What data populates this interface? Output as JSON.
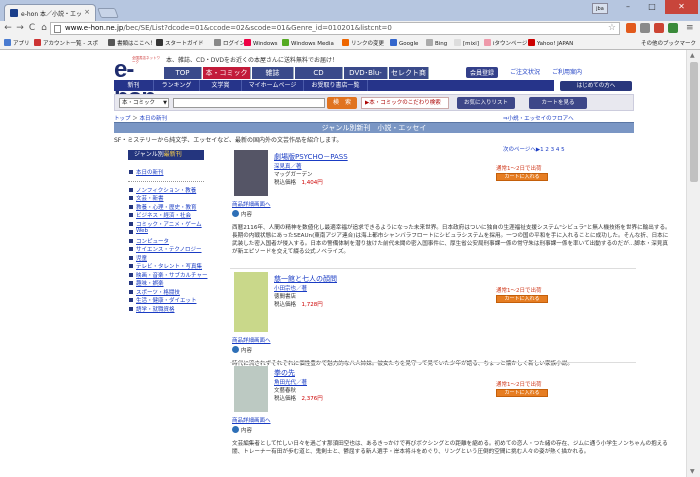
{
  "browser": {
    "tab_title": "e-hon 本／小説・エッセイ",
    "tab_close": "×",
    "user_badge": "jba",
    "win_min": "–",
    "win_max": "□",
    "win_close": "✕",
    "back": "←",
    "forward": "→",
    "reload": "C",
    "home": "⌂",
    "url_host": "www.e-hon.ne.jp",
    "url_path": "/bec/SE/List?dcode=01&ccode=02&scode=01&Genre_id=010201&listcnt=0",
    "star": "☆",
    "menu": "≡",
    "bookmarks": [
      {
        "label": "アプリ",
        "color": "#4a7bd0"
      },
      {
        "label": "アカウント一覧 - スポ",
        "color": "#c33"
      },
      {
        "label": "書類はここへ！",
        "color": "#555"
      },
      {
        "label": "スタートガイド",
        "color": "#333"
      },
      {
        "label": "ログイン",
        "color": "#888"
      },
      {
        "label": "Windows",
        "color": "#e04"
      },
      {
        "label": "Windows Media",
        "color": "#5a2"
      },
      {
        "label": "リンクの変更",
        "color": "#e60"
      },
      {
        "label": "Google",
        "color": "#36c"
      },
      {
        "label": "Bing",
        "color": "#aaa"
      },
      {
        "label": "[mixi]",
        "color": "#ddd"
      },
      {
        "label": "iタウンページ",
        "color": "#e9a"
      },
      {
        "label": "Yahoo! JAPAN",
        "color": "#c00"
      }
    ],
    "other_bookmarks": "その他のブックマーク"
  },
  "site": {
    "logo_text": "e-hon",
    "logo_sub": "全国書店ネットワーク",
    "tagline": "本、雑誌、CD・DVDをお近くの本屋さんに送料無料でお届け！",
    "main_nav": [
      "TOP",
      "本・コミック",
      "雑誌",
      "CD",
      "DVD･Blu-ray",
      "セレクト商品"
    ],
    "member": "会員登録",
    "help1": "ご注文状況",
    "help2": "ご利用案内",
    "beginner": "はじめての方へ",
    "sub_nav": [
      "新刊",
      "ランキング",
      "文学賞",
      "マイホームページ",
      "お受取り書店一覧"
    ],
    "search_select": "本・コミック",
    "search_select_arrow": "▼",
    "search_button": "検　索",
    "kodawari": "▶本・コミックのこだわり検索",
    "favorites": "お気に入りリスト",
    "cart": "カートを見る",
    "crumb": [
      "トップ",
      "本日の新刊"
    ],
    "crumb_sep": " ＞ ",
    "cat_link": "⇒小説・エッセイのフロアへ",
    "genre_title": "ジャンル別新刊　小説・エッセイ",
    "genre_desc": "SF・ミステリーから純文学、エッセイなど、最新の国内外の文芸作品を紹介します。",
    "pager": "次のページへ▶1 2 3 4 5"
  },
  "sidebar": {
    "head1": "ジャンル別",
    "head2": "最新刊",
    "items": [
      "本日の新刊",
      "ノンフィクション・教養",
      "文芸・新書",
      "教養・心理・歴史・教育",
      "ビジネス・経済・社会",
      "コミック・アニメ・ゲーム",
      "Web",
      "コンピュータ",
      "サイエンス・テクノロジー",
      "児童",
      "テレビ・タレント・写真集",
      "映画・音楽・サブカルチャー",
      "趣味・娯楽",
      "スポーツ・格闘技",
      "生活・健康・ダイエット",
      "語学・就職資格"
    ]
  },
  "products": [
    {
      "title": "劇場版PSYCHO－PASS",
      "author": "深見真／著",
      "publisher": "マッグガーデン",
      "price_label": "税込価格",
      "price": "1,404円",
      "detail": "商品詳細画面へ",
      "content_label": "内容",
      "body": "西暦2116年、人間の精神を数値化し最適幸福が追求できるようになった未来世界。日本政府はついに独自の生涯福祉支援システム\"シビュラ\"と無人機技術を世界に輸出する。長期の内戦状態にあったSEAUn(東南アジア連合)は海上都市シャンバラフロートにシビュラシステムを採用。一つの国の平和を手に入れることに成功した。そんな折、日本に武装した密入国者が侵入する。日本の警備体制を潜り抜けた前代未聞の密入国事件に、厚生省公安局刑事課一係の常守朱は刑事課一係を率いて出動するのだが…脚本・深見真が新エピソードを交えて綴る公式ノベライズ。",
      "ship": "通常1～2日で出荷",
      "addcart": "カートに入れる",
      "cover_color": "#556"
    },
    {
      "title": "慈一館と七人の顔問",
      "author": "小田宗也／著",
      "publisher": "徳間書店",
      "price_label": "税込価格",
      "price": "1,728円",
      "detail": "商品詳細画面へ",
      "content_label": "内容",
      "body": "時代に流されずそれぞれに個性豊かで魅力的な八人姉妹。彼女たちを見守って見ていた少年が語る、ちょっと懐かしく新しい家族小説。",
      "ship": "通常1～2日で出荷",
      "addcart": "カートに入れる",
      "cover_color": "#c9d88a"
    },
    {
      "title": "拳の先",
      "author": "角田光代／著",
      "publisher": "文藝春秋",
      "price_label": "税込価格",
      "price": "2,376円",
      "detail": "商品詳細画面へ",
      "content_label": "内容",
      "body": "文芸編集者として忙しい日々を過ごす那須田空也は、あるきっかけで再びボクシングとの距離を縮める。初めての恋人・つた緒の存在、ジムに通う小学生ノンちゃんの抱える闇、トレーナー有田が歩む道と、鬼剣士と、鬱屈する新人選手・岸本将斗をめぐり、リングという圧倒的空間に挑む人々の姿が熱く描かれる。",
      "ship": "通常1～2日で出荷",
      "addcart": "カートに入れる",
      "cover_color": "#bcc9c2"
    }
  ]
}
